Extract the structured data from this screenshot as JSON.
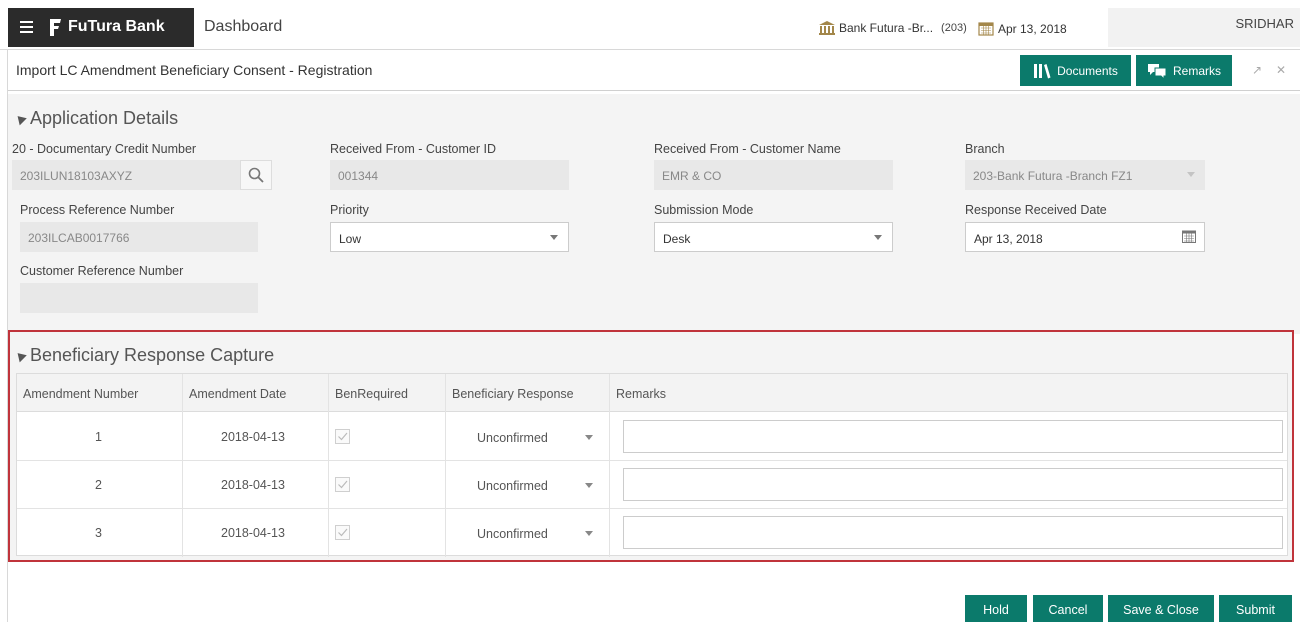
{
  "app": {
    "brand": "FuTura Bank",
    "dashboard": "Dashboard",
    "branch": "Bank Futura -Br...",
    "branch_code": "(203)",
    "date": "Apr 13, 2018",
    "user": "SRIDHAR"
  },
  "header": {
    "title": "Import LC Amendment Beneficiary Consent - Registration",
    "documents_label": "Documents",
    "remarks_label": "Remarks",
    "minimize": "↗",
    "close": "✕"
  },
  "application_details": {
    "title": "Application Details",
    "dc_number_label": "20 - Documentary Credit Number",
    "dc_number": "203ILUN18103AXYZ",
    "customer_id_label": "Received From - Customer ID",
    "customer_id": "001344",
    "customer_name_label": "Received From - Customer Name",
    "customer_name": "EMR & CO",
    "branch_label": "Branch",
    "branch": "203-Bank Futura -Branch FZ1",
    "process_ref_label": "Process Reference Number",
    "process_ref": "203ILCAB0017766",
    "priority_label": "Priority",
    "priority": "Low",
    "submission_label": "Submission Mode",
    "submission": "Desk",
    "response_date_label": "Response Received Date",
    "response_date": "Apr 13, 2018",
    "customer_ref_label": "Customer Reference Number",
    "customer_ref": ""
  },
  "beneficiary": {
    "title": "Beneficiary Response Capture",
    "columns": [
      "Amendment Number",
      "Amendment Date",
      "BenRequired",
      "Beneficiary Response",
      "Remarks"
    ],
    "rows": [
      {
        "number": "1",
        "date": "2018-04-13",
        "ben_required": true,
        "response": "Unconfirmed",
        "remarks": ""
      },
      {
        "number": "2",
        "date": "2018-04-13",
        "ben_required": true,
        "response": "Unconfirmed",
        "remarks": ""
      },
      {
        "number": "3",
        "date": "2018-04-13",
        "ben_required": true,
        "response": "Unconfirmed",
        "remarks": ""
      }
    ]
  },
  "footer": {
    "hold": "Hold",
    "cancel": "Cancel",
    "save_close": "Save & Close",
    "submit": "Submit"
  },
  "colors": {
    "accent": "#0b7a6b",
    "highlight_border": "#c0343b",
    "brand_bg": "#2b2b2b"
  }
}
